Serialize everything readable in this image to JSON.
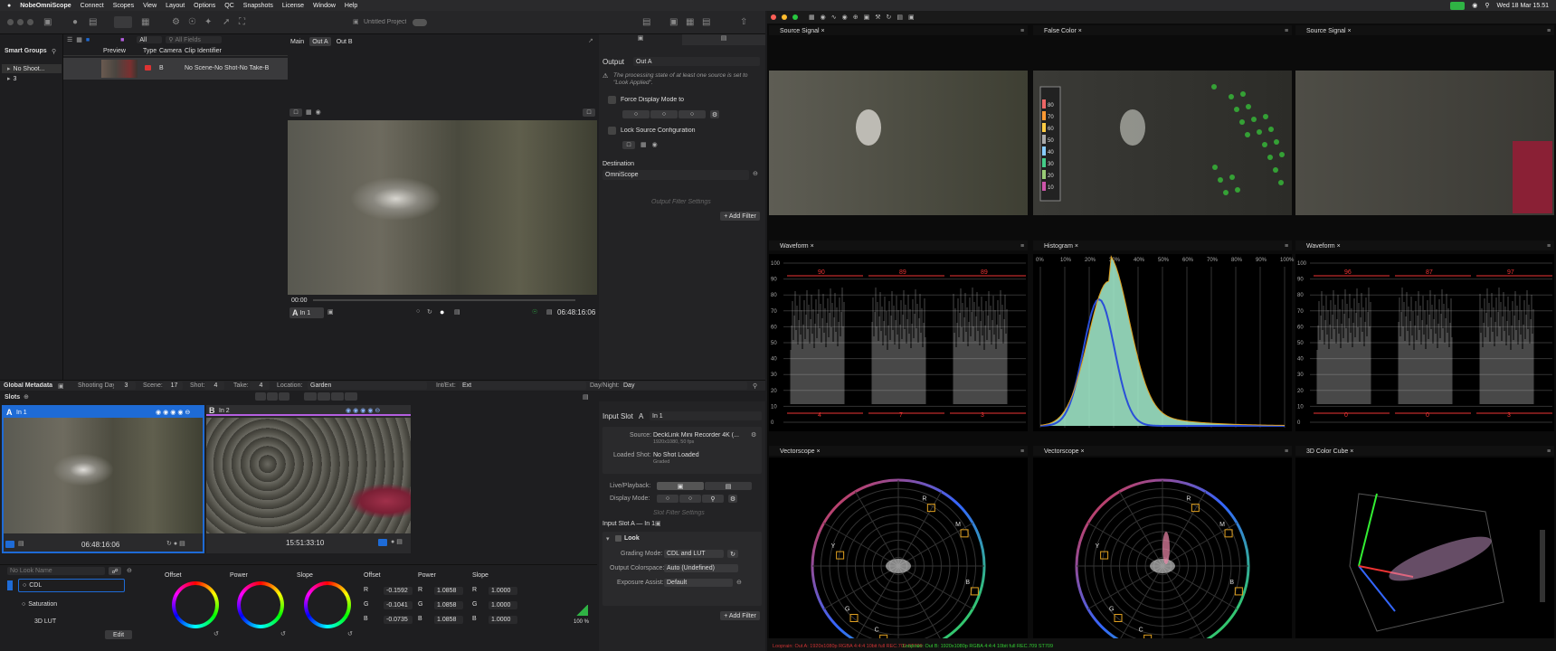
{
  "menubar": {
    "app": "NobeOmniScope",
    "items": [
      "Connect",
      "Scopes",
      "View",
      "Layout",
      "Options",
      "QC",
      "Snapshots",
      "License",
      "Window",
      "Help"
    ],
    "clock": "Wed 18 Mar 15.51"
  },
  "toolbar": {
    "project": "Untitled Project"
  },
  "smart_groups": {
    "title": "Smart Groups",
    "filter_all": "All",
    "search_placeholder": "All Fields",
    "items": [
      "No Shoot...",
      "3"
    ]
  },
  "clips": {
    "headers": [
      "Preview",
      "Type",
      "Camera",
      "Clip Identifier"
    ],
    "row": {
      "camera": "B",
      "identifier": "No Scene-No Shot-No Take-B"
    }
  },
  "tabs": {
    "main": "Main",
    "outA": "Out A",
    "outB": "Out B"
  },
  "viewer": {
    "time_start": "00:00",
    "input": "In 1",
    "timecode": "06:48:16:06",
    "slot_letter": "A"
  },
  "output": {
    "label": "Output",
    "value": "Out A",
    "warning": "The processing state of at least one source is set to \"Look Applied\".",
    "force_display": "Force Display Mode to",
    "lock_source": "Lock Source Configuration",
    "destination": "Destination",
    "dest_value": "OmniScope",
    "filter_settings": "Output Filter Settings",
    "add_filter": "+ Add Filter"
  },
  "metadata": {
    "title": "Global Metadata",
    "shooting_day_label": "Shooting Day:",
    "shooting_day": "3",
    "scene_label": "Scene:",
    "scene": "17",
    "shot_label": "Shot:",
    "shot": "4",
    "take_label": "Take:",
    "take": "4",
    "location_label": "Location:",
    "location": "Garden",
    "intext_label": "Int/Ext:",
    "intext": "Ext",
    "daynight_label": "Day/Night:",
    "daynight": "Day"
  },
  "slots": {
    "title": "Slots",
    "a_letter": "A",
    "a_name": "In 1",
    "a_tc": "06:48:16:06",
    "b_letter": "B",
    "b_name": "In 2",
    "b_tc": "15:51:33:10"
  },
  "look": {
    "placeholder": "No Look Name",
    "items": [
      "CDL",
      "Saturation",
      "3D LUT"
    ],
    "edit": "Edit",
    "wheels": [
      "Offset",
      "Power",
      "Slope"
    ],
    "cols": [
      "Offset",
      "Power",
      "Slope"
    ],
    "rows": [
      [
        "R",
        "-0.1592",
        "R",
        "1.0858",
        "R",
        "1.0000"
      ],
      [
        "G",
        "-0.1041",
        "G",
        "1.0858",
        "G",
        "1.0000"
      ],
      [
        "B",
        "-0.0735",
        "B",
        "1.0858",
        "B",
        "1.0000"
      ]
    ],
    "percent": "100 %"
  },
  "input_slot": {
    "title": "Input Slot",
    "letter": "A",
    "name": "In 1",
    "source_label": "Source:",
    "source": "DeckLink Mini Recorder 4K (...",
    "source_sub": "1920x1080, 50 fps",
    "loaded_label": "Loaded Shot:",
    "loaded": "No Shot Loaded",
    "loaded_sub": "Graded",
    "live_label": "Live/Playback:",
    "display_label": "Display Mode:",
    "filter_settings": "Slot Filter Settings",
    "slot_desc": "Input Slot A — In 1",
    "look": "Look",
    "grading_label": "Grading Mode:",
    "grading": "CDL and LUT",
    "colorspace_label": "Output Colorspace:",
    "colorspace": "Auto (Undefined)",
    "exposure_label": "Exposure Assist:",
    "exposure": "Default",
    "add_filter": "+ Add Filter"
  },
  "scopes": {
    "source1": "Source Signal",
    "false_color": "False Color",
    "source2": "Source Signal",
    "waveform1": "Waveform",
    "histogram": "Histogram",
    "waveform2": "Waveform",
    "vector1": "Vectorscope",
    "vector2": "Vectorscope",
    "cube": "3D Color Cube",
    "wf1_peaks": [
      "90",
      "89",
      "89"
    ],
    "wf1_lows": [
      "4",
      "7",
      "3"
    ],
    "wf2_peaks": [
      "96",
      "87",
      "97"
    ],
    "wf2_lows": [
      "0",
      "0",
      "3"
    ],
    "wf_ticks": [
      "100",
      "90",
      "80",
      "70",
      "60",
      "50",
      "40",
      "30",
      "20",
      "10",
      "0"
    ],
    "hist_ticks": [
      "0%",
      "10%",
      "20%",
      "30%",
      "40%",
      "50%",
      "60%",
      "70%",
      "80%",
      "90%",
      "100%"
    ],
    "fc_scale": [
      "80",
      "70",
      "60",
      "50",
      "40",
      "30",
      "20",
      "10"
    ],
    "vector_labels": [
      "R",
      "M",
      "B",
      "C",
      "G",
      "Y"
    ],
    "statusbar": [
      "Looprain: Out A: 1920x1080p RGBA 4:4:4 10bit full REC.709 ST709",
      "Looprain: Out B: 1920x1080p RGBA 4:4:4 10bit full REC.709 ST709"
    ]
  }
}
